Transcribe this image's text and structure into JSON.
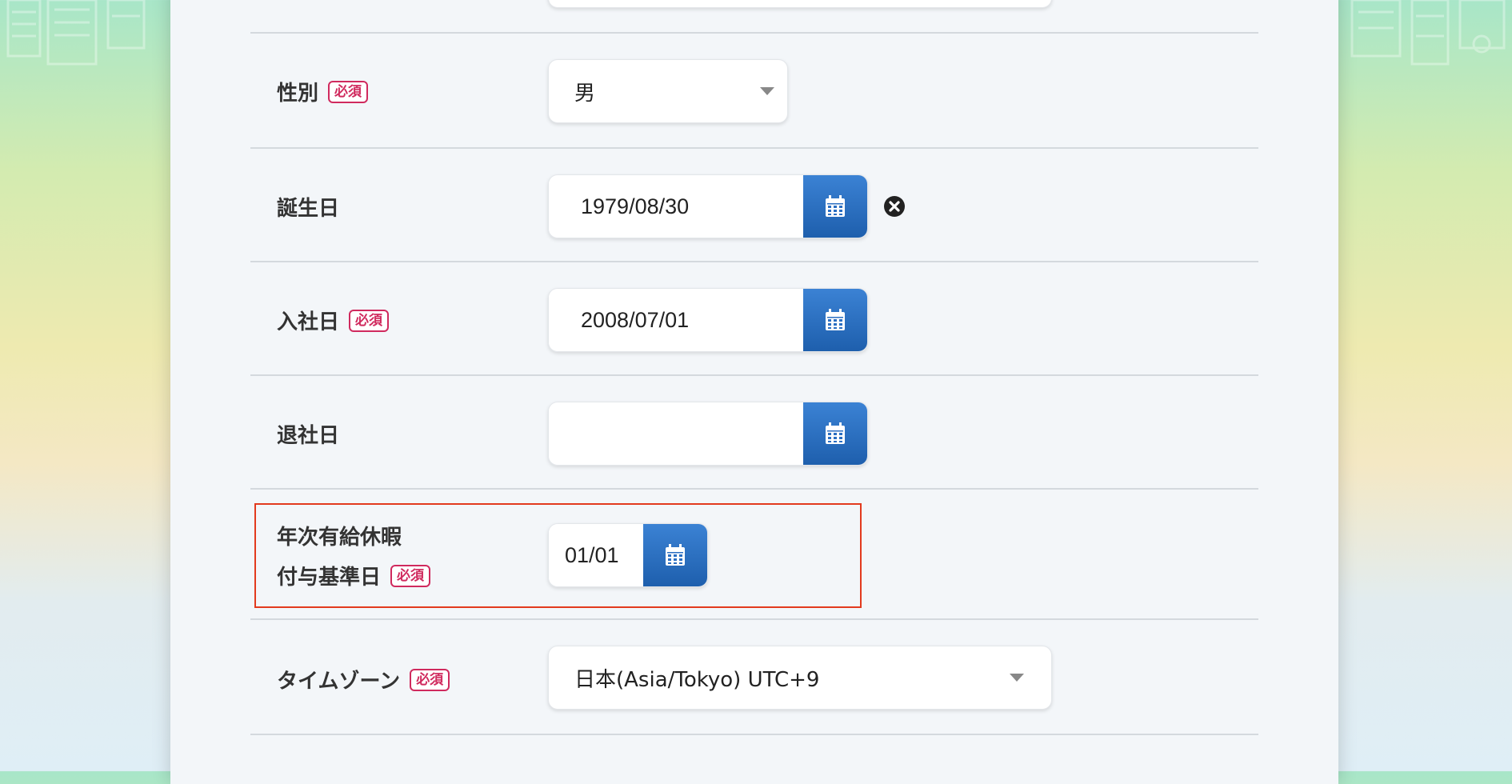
{
  "required_badge": "必須",
  "fields": {
    "gender": {
      "label": "性別",
      "value": "男"
    },
    "birthday": {
      "label": "誕生日",
      "value": "1979/08/30"
    },
    "join_date": {
      "label": "入社日",
      "value": "2008/07/01"
    },
    "leave_date": {
      "label": "退社日",
      "value": ""
    },
    "paid_leave": {
      "label_line1": "年次有給休暇",
      "label_line2": "付与基準日",
      "value": "01/01"
    },
    "timezone": {
      "label": "タイムゾーン",
      "value": "日本(Asia/Tokyo) UTC+9"
    }
  },
  "colors": {
    "calendar_button": "#2a6ec2",
    "required_badge": "#d02a5e",
    "highlight_border": "#e23a1e"
  },
  "icons": {
    "calendar": "calendar-icon",
    "clear": "close-circle-icon",
    "dropdown": "caret-down-icon"
  }
}
